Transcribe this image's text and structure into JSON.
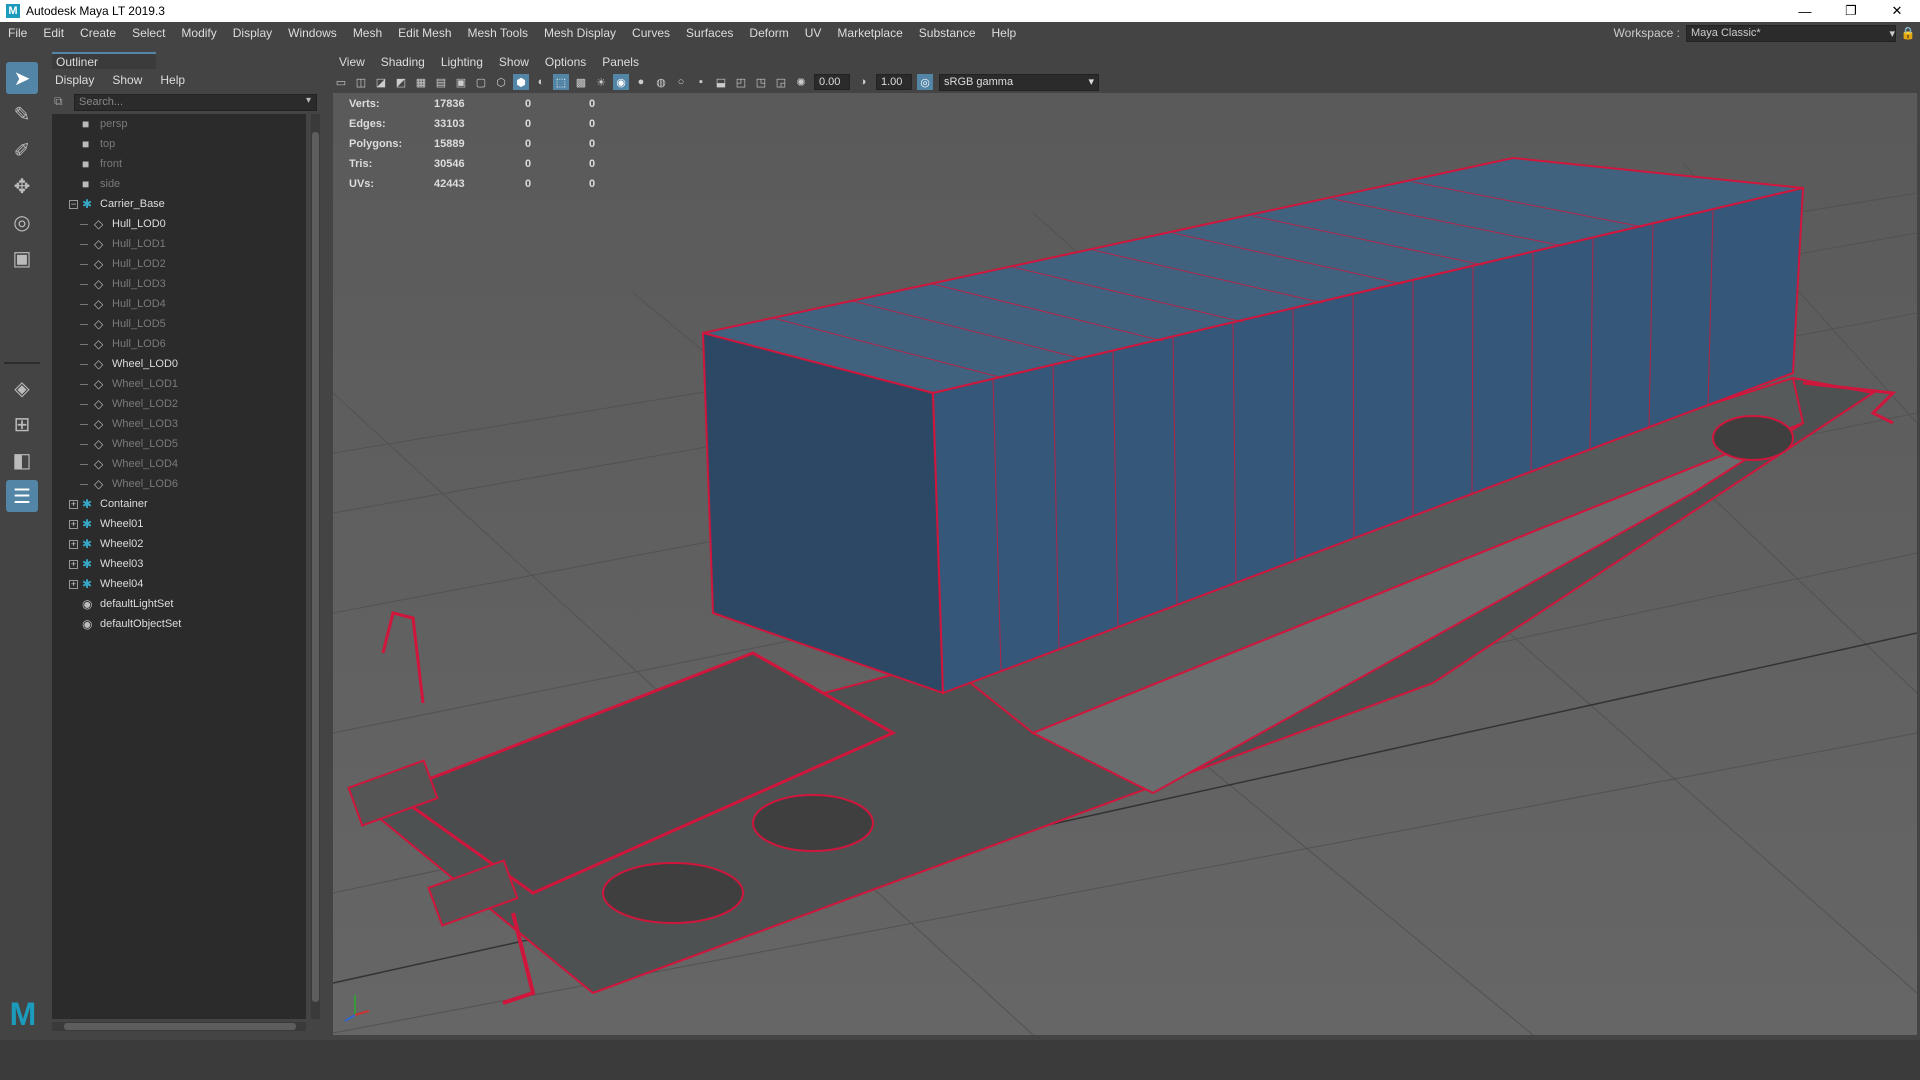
{
  "window": {
    "title": "Autodesk Maya LT 2019.3",
    "minimize": "—",
    "restore": "❐",
    "close": "✕"
  },
  "menubar": [
    "File",
    "Edit",
    "Create",
    "Select",
    "Modify",
    "Display",
    "Windows",
    "Mesh",
    "Edit Mesh",
    "Mesh Tools",
    "Mesh Display",
    "Curves",
    "Surfaces",
    "Deform",
    "UV",
    "Marketplace",
    "Substance",
    "Help"
  ],
  "workspace": {
    "label": "Workspace :",
    "value": "Maya Classic*"
  },
  "outliner": {
    "tab": "Outliner",
    "menu": [
      "Display",
      "Show",
      "Help"
    ],
    "search_placeholder": "Search...",
    "items": [
      {
        "label": "persp",
        "kind": "camera"
      },
      {
        "label": "top",
        "kind": "camera"
      },
      {
        "label": "front",
        "kind": "camera"
      },
      {
        "label": "side",
        "kind": "camera"
      },
      {
        "label": "Carrier_Base",
        "kind": "group",
        "expanded": true
      },
      {
        "label": "Hull_LOD0",
        "kind": "mesh"
      },
      {
        "label": "Hull_LOD1",
        "kind": "mesh-dim"
      },
      {
        "label": "Hull_LOD2",
        "kind": "mesh-dim"
      },
      {
        "label": "Hull_LOD3",
        "kind": "mesh-dim"
      },
      {
        "label": "Hull_LOD4",
        "kind": "mesh-dim"
      },
      {
        "label": "Hull_LOD5",
        "kind": "mesh-dim"
      },
      {
        "label": "Hull_LOD6",
        "kind": "mesh-dim"
      },
      {
        "label": "Wheel_LOD0",
        "kind": "mesh"
      },
      {
        "label": "Wheel_LOD1",
        "kind": "mesh-dim"
      },
      {
        "label": "Wheel_LOD2",
        "kind": "mesh-dim"
      },
      {
        "label": "Wheel_LOD3",
        "kind": "mesh-dim"
      },
      {
        "label": "Wheel_LOD5",
        "kind": "mesh-dim"
      },
      {
        "label": "Wheel_LOD4",
        "kind": "mesh-dim"
      },
      {
        "label": "Wheel_LOD6",
        "kind": "mesh-dim"
      },
      {
        "label": "Container",
        "kind": "group"
      },
      {
        "label": "Wheel01",
        "kind": "group"
      },
      {
        "label": "Wheel02",
        "kind": "group"
      },
      {
        "label": "Wheel03",
        "kind": "group"
      },
      {
        "label": "Wheel04",
        "kind": "group"
      },
      {
        "label": "defaultLightSet",
        "kind": "set"
      },
      {
        "label": "defaultObjectSet",
        "kind": "set"
      }
    ]
  },
  "viewport": {
    "menu": [
      "View",
      "Shading",
      "Lighting",
      "Show",
      "Options",
      "Panels"
    ],
    "exposure": "0.00",
    "gamma": "1.00",
    "colorspace": "sRGB gamma",
    "hud": [
      {
        "label": "Verts:",
        "v1": "17836",
        "v2": "0",
        "v3": "0"
      },
      {
        "label": "Edges:",
        "v1": "33103",
        "v2": "0",
        "v3": "0"
      },
      {
        "label": "Polygons:",
        "v1": "15889",
        "v2": "0",
        "v3": "0"
      },
      {
        "label": "Tris:",
        "v1": "30546",
        "v2": "0",
        "v3": "0"
      },
      {
        "label": "UVs:",
        "v1": "42443",
        "v2": "0",
        "v3": "0"
      }
    ]
  },
  "colors": {
    "accent": "#5285a6",
    "wire": "#d0163c",
    "container": "#2f4f6e",
    "viewport": "#5f5f5f"
  }
}
